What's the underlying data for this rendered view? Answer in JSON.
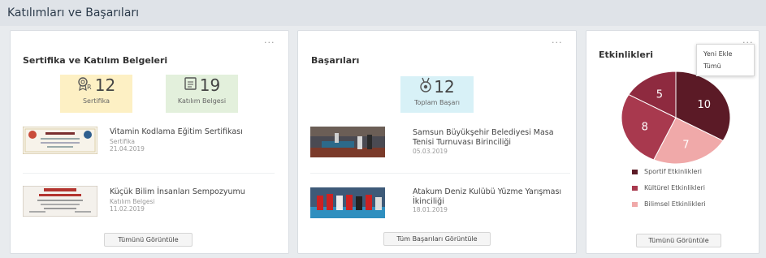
{
  "header": {
    "title": "Katılımları ve Başarıları"
  },
  "certificates": {
    "title": "Sertifika ve Katılım Belgeleri",
    "menu": "...",
    "stats": [
      {
        "value": "12",
        "label": "Sertifika",
        "icon": "certificate-icon",
        "bg": "#fdf0c4"
      },
      {
        "value": "19",
        "label": "Katılım Belgesi",
        "icon": "document-icon",
        "bg": "#e3f0dc"
      }
    ],
    "items": [
      {
        "title": "Vitamin Kodlama Eğitim Sertifikası",
        "type": "Sertifika",
        "date": "21.04.2019"
      },
      {
        "title": "Küçük Bilim İnsanları Sempozyumu",
        "type": "Katılım Belgesi",
        "date": "11.02.2019"
      }
    ],
    "button": "Tümünü Görüntüle"
  },
  "achievements": {
    "title": "Başarıları",
    "menu": "...",
    "stat": {
      "value": "12",
      "label": "Toplam Başarı",
      "icon": "medal-icon",
      "bg": "#d8f1f7"
    },
    "items": [
      {
        "title": "Samsun Büyükşehir Belediyesi Masa Tenisi Turnuvası Birinciliği",
        "date": "05.03.2019"
      },
      {
        "title": "Atakum Deniz Kulübü Yüzme Yarışması İkinciliği",
        "date": "18.01.2019"
      }
    ],
    "button": "Tüm Başarıları Görüntüle"
  },
  "activities": {
    "title": "Etkinlikleri",
    "menu": "...",
    "dropdown": [
      "Yeni Ekle",
      "Tümü"
    ],
    "button": "Tümünü Görüntüle",
    "chart_data": {
      "type": "pie",
      "categories": [
        "Sportif Etkinlikleri",
        "Kültürel Etkinlikleri",
        "Bilimsel Etkinlikleri"
      ],
      "values": [
        10,
        8,
        7
      ],
      "extra_slice": {
        "value": 5,
        "color": "#8e2a3f"
      },
      "colors": [
        "#5b1a26",
        "#a8394e",
        "#f0a9a9"
      ]
    }
  }
}
